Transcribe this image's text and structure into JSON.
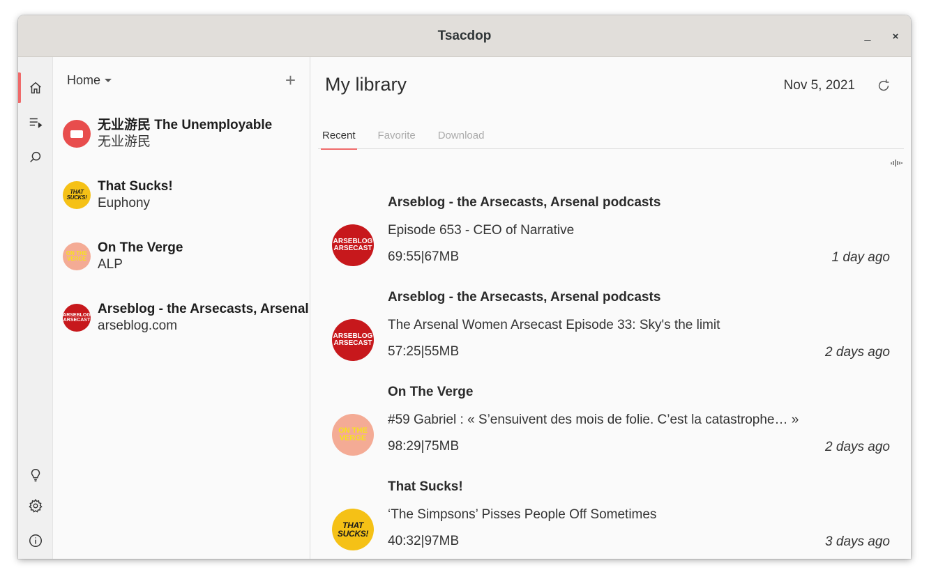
{
  "window": {
    "title": "Tsacdop",
    "min_label": "_",
    "close_label": "×"
  },
  "rail": {
    "items": [
      {
        "icon": "home-icon",
        "active": true
      },
      {
        "icon": "playlist-icon",
        "active": false
      },
      {
        "icon": "search-icon",
        "active": false
      },
      {
        "icon": "lightbulb-icon",
        "active": false
      },
      {
        "icon": "gear-icon",
        "active": false
      },
      {
        "icon": "info-icon",
        "active": false
      }
    ]
  },
  "sidebar": {
    "group_label": "Home",
    "add_icon": "plus-icon",
    "podcasts": [
      {
        "name": "无业游民 The Unemployable",
        "author": "无业游民",
        "cover": "unemployable"
      },
      {
        "name": "That Sucks!",
        "author": "Euphony",
        "cover": "sucks"
      },
      {
        "name": "On The Verge",
        "author": "ALP",
        "cover": "verge"
      },
      {
        "name": "Arseblog - the Arsecasts, Arsenal",
        "author": "arseblog.com",
        "cover": "arse"
      }
    ]
  },
  "library": {
    "title": "My library",
    "date": "Nov 5, 2021",
    "tabs": [
      {
        "label": "Recent",
        "active": true
      },
      {
        "label": "Favorite",
        "active": false
      },
      {
        "label": "Download",
        "active": false
      }
    ],
    "episodes": [
      {
        "show": "Arseblog - the Arsecasts, Arsenal podcasts",
        "title": "Episode 653 - CEO of Narrative",
        "meta": "69:55|67MB",
        "ago": "1 day ago",
        "cover": "arse"
      },
      {
        "show": "Arseblog - the Arsecasts, Arsenal podcasts",
        "title": "The Arsenal Women Arsecast Episode 33: Sky's the limit",
        "meta": "57:25|55MB",
        "ago": "2 days ago",
        "cover": "arse"
      },
      {
        "show": "On The Verge",
        "title": "#59 Gabriel : «  S’ensuivent des mois de folie. C’est la catastrophe… »",
        "meta": "98:29|75MB",
        "ago": "2 days ago",
        "cover": "verge"
      },
      {
        "show": "That Sucks!",
        "title": "‘The Simpsons’ Pisses People Off Sometimes",
        "meta": "40:32|97MB",
        "ago": "3 days ago",
        "cover": "sucks"
      }
    ]
  },
  "covers": {
    "sucks": "THAT SUCKS!",
    "verge": "ON THE VERGE",
    "arse": "ARSEBLOG ARSECAST"
  },
  "colors": {
    "accent": "#ef6a6a",
    "titlebar": "#e1deda"
  }
}
